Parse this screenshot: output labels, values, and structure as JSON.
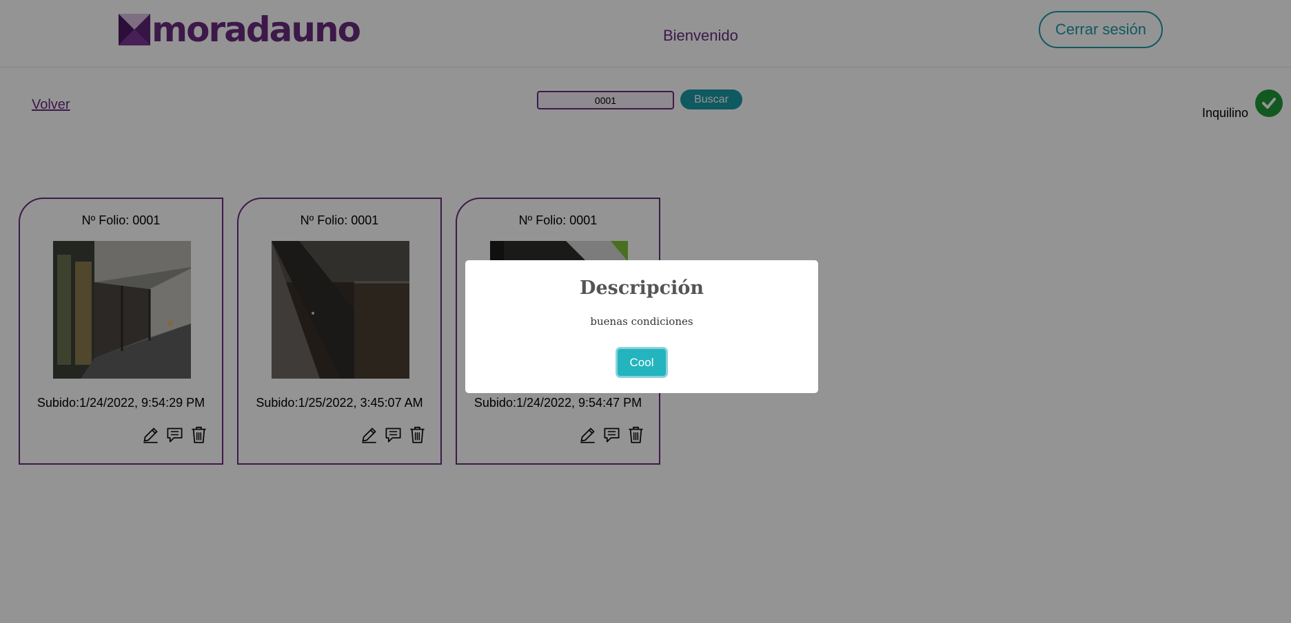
{
  "header": {
    "brand": "moradauno",
    "welcome": "Bienvenido",
    "logout_label": "Cerrar sesión"
  },
  "toolbar": {
    "back_label": "Volver",
    "search_value": "0001",
    "search_label": "Buscar"
  },
  "role": {
    "label": "Inquilino",
    "status": "check-icon"
  },
  "cards": [
    {
      "folio": "Nº Folio: 0001",
      "date": "Subido:1/24/2022, 9:54:29 PM"
    },
    {
      "folio": "Nº Folio: 0001",
      "date": "Subido:1/25/2022, 3:45:07 AM"
    },
    {
      "folio": "Nº Folio: 0001",
      "date": "Subido:1/24/2022, 9:54:47 PM"
    }
  ],
  "modal": {
    "title": "Descripción",
    "text": "buenas condiciones",
    "button_label": "Cool"
  },
  "colors": {
    "brand_purple": "#6a2c7f",
    "accent_teal": "#1a9aa6",
    "success_green": "#1f9a3a"
  }
}
